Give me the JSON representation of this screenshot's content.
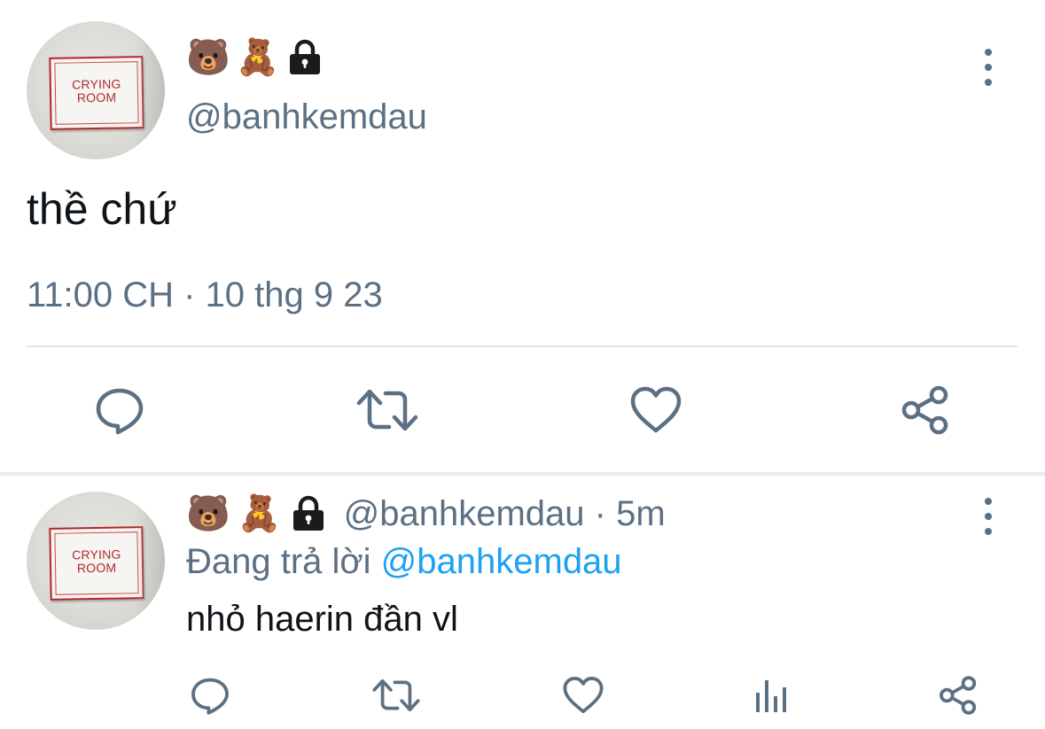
{
  "colors": {
    "text_primary": "#0f1419",
    "text_secondary": "#5b7083",
    "link": "#1da1f2",
    "divider": "#e1e8ed",
    "sign_red": "#b02a30"
  },
  "main_tweet": {
    "avatar": {
      "sign_text": "CRYING\nROOM"
    },
    "name_emojis": [
      "🐻",
      "🧸"
    ],
    "protected_icon": "lock-icon",
    "handle": "@banhkemdau",
    "text": "thề chứ",
    "timestamp": "11:00 CH · 10 thg 9 23",
    "more_icon": "more-vertical-icon",
    "actions": [
      {
        "icon": "reply-icon"
      },
      {
        "icon": "retweet-icon"
      },
      {
        "icon": "like-icon"
      },
      {
        "icon": "share-icon"
      }
    ]
  },
  "reply_tweet": {
    "avatar": {
      "sign_text": "CRYING\nROOM"
    },
    "name_emojis": [
      "🐻",
      "🧸"
    ],
    "protected_icon": "lock-icon",
    "handle_time": "@banhkemdau · 5m",
    "replying_to_prefix": "Đang trả lời ",
    "replying_to_handle": "@banhkemdau",
    "text": "nhỏ haerin đần vl",
    "more_icon": "more-vertical-icon",
    "actions": [
      {
        "icon": "reply-icon"
      },
      {
        "icon": "retweet-icon"
      },
      {
        "icon": "like-icon"
      },
      {
        "icon": "analytics-icon"
      },
      {
        "icon": "share-icon"
      }
    ]
  }
}
